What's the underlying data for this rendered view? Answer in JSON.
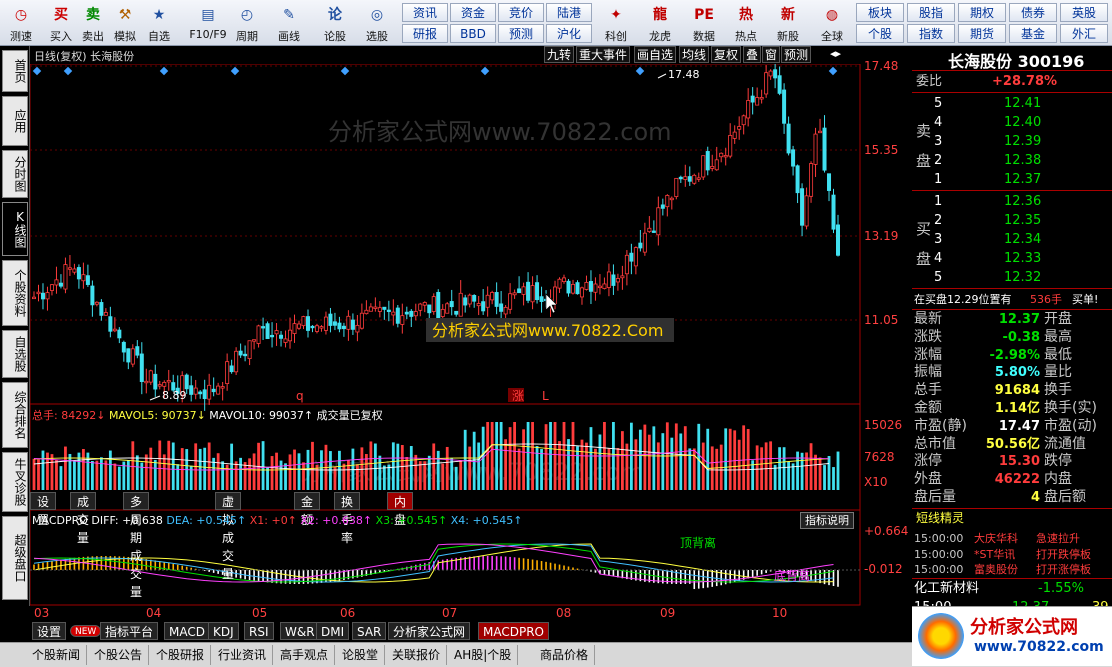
{
  "toolbar": {
    "buttons": [
      {
        "label": "测速",
        "icon": "clock-icon",
        "color": "#cc0000"
      },
      {
        "label": "买入",
        "icon": "buy-icon",
        "color": "#cc0000"
      },
      {
        "label": "卖出",
        "icon": "sell-icon",
        "color": "#008800"
      },
      {
        "label": "模拟",
        "icon": "hammer-icon",
        "color": "#b06000"
      },
      {
        "label": "自选",
        "icon": "star-icon",
        "color": "#2050a0"
      },
      {
        "label": "F10/F9",
        "icon": "document-icon",
        "color": "#2050a0"
      },
      {
        "label": "周期",
        "icon": "cycle-icon",
        "color": "#2050a0"
      },
      {
        "label": "画线",
        "icon": "pencil-icon",
        "color": "#2050a0"
      },
      {
        "label": "论股",
        "icon": "chat-icon",
        "color": "#2050a0"
      },
      {
        "label": "选股",
        "icon": "select-icon",
        "color": "#2050a0"
      }
    ],
    "grid_buttons": [
      [
        "资讯",
        "资金",
        "竞价",
        "陆港"
      ],
      [
        "研报",
        "BBD",
        "预测",
        "沪化"
      ]
    ],
    "app_buttons": [
      {
        "label": "科创",
        "icon": "sparkle-icon"
      },
      {
        "label": "龙虎",
        "icon": "dragon-icon"
      },
      {
        "label": "数据",
        "icon": "pe-icon"
      },
      {
        "label": "热点",
        "icon": "hot-icon"
      },
      {
        "label": "新股",
        "icon": "new-stock-icon"
      },
      {
        "label": "全球",
        "icon": "globe-icon"
      }
    ],
    "right_grid": [
      [
        "板块",
        "股指",
        "期权",
        "债券",
        "英股"
      ],
      [
        "个股",
        "指数",
        "期货",
        "基金",
        "外汇"
      ]
    ]
  },
  "left_tabs": [
    "首页",
    "应用",
    "分时图",
    "K线图",
    "个股资料",
    "自选股",
    "综合排名",
    "牛叉诊股",
    "超级盘口"
  ],
  "left_active": "K线图",
  "chart_title": {
    "left": "日线(复权)  长海股份",
    "right_tools": [
      "九转",
      "重大事件",
      "画自选",
      "均线",
      "复权",
      "叠",
      "窗",
      "预测"
    ]
  },
  "watermark_text": "分析家公式网www.70822.com",
  "watermark_label": "分析家公式网www.70822.Com",
  "price_axis": [
    "17.48",
    "15.35",
    "13.19",
    "11.05"
  ],
  "annotations": {
    "high": "17.48",
    "low": "8.89",
    "marks": [
      "q",
      "涨",
      "L"
    ]
  },
  "volume_header": {
    "total_label": "总手:",
    "total": "84292↓",
    "mavol5_label": "MAVOL5:",
    "mavol5": "90737↓",
    "mavol10_label": "MAVOL10:",
    "mavol10": "99037↑",
    "note": "成交量已复权"
  },
  "volume_axis": [
    "15026",
    "7628",
    "X10"
  ],
  "sub_tabs": [
    "设置",
    "成交量",
    "多周期成交量",
    "虚拟成交量",
    "金额",
    "换手率",
    "内盘"
  ],
  "sub_tab_active": "内盘",
  "macd_header": {
    "name": "MACDPRO DIFF:",
    "diff": "+0.638",
    "dea": "DEA: +0.545↑",
    "x1": "X1: +0↑",
    "x2": "X2: +0.638↑",
    "x3": "X3: +0.545↑",
    "x4": "X4: +0.545↑",
    "help": "指标说明"
  },
  "macd_axis": [
    "+0.664",
    "-0.012"
  ],
  "macd_annotations": [
    "顶背离",
    "底背离"
  ],
  "months": [
    "03",
    "04",
    "05",
    "06",
    "07",
    "08",
    "09",
    "10"
  ],
  "bottom_tabs": [
    "设置",
    "NEW",
    "指标平台",
    "MACD",
    "KDJ",
    "RSI",
    "W&R",
    "DMI",
    "SAR",
    "分析家公式网",
    "MACDPRO"
  ],
  "bottom_active": "MACDPRO",
  "status_tabs": [
    "个股新闻",
    "个股公告",
    "个股研报",
    "行业资讯",
    "高手观点",
    "论股堂",
    "关联报价",
    "AH股|个股",
    "商品价格"
  ],
  "right": {
    "stock_name": "长海股份",
    "stock_code": "300196",
    "weibi_label": "委比",
    "weibi": "+28.78%",
    "sell_label": "卖盘",
    "buy_label": "买盘",
    "sells": [
      {
        "n": "5",
        "p": "12.41",
        "v": ""
      },
      {
        "n": "4",
        "p": "12.40",
        "v": ""
      },
      {
        "n": "3",
        "p": "12.39",
        "v": ""
      },
      {
        "n": "2",
        "p": "12.38",
        "v": ""
      },
      {
        "n": "1",
        "p": "12.37",
        "v": ""
      }
    ],
    "buys": [
      {
        "n": "1",
        "p": "12.36",
        "v": ""
      },
      {
        "n": "2",
        "p": "12.35",
        "v": ""
      },
      {
        "n": "3",
        "p": "12.34",
        "v": ""
      },
      {
        "n": "4",
        "p": "12.33",
        "v": ""
      },
      {
        "n": "5",
        "p": "12.32",
        "v": ""
      }
    ],
    "buyline": {
      "left": "在买盘12.29位置有",
      "qty": "536手",
      "right": "买单!"
    },
    "quotes": [
      {
        "k": "最新",
        "v": "12.37",
        "c": "green",
        "k2": "开盘"
      },
      {
        "k": "涨跌",
        "v": "-0.38",
        "c": "green",
        "k2": "最高"
      },
      {
        "k": "涨幅",
        "v": "-2.98%",
        "c": "green",
        "k2": "最低"
      },
      {
        "k": "振幅",
        "v": "5.80%",
        "c": "cyan",
        "k2": "量比"
      },
      {
        "k": "总手",
        "v": "91684",
        "c": "yellow",
        "k2": "换手"
      },
      {
        "k": "金额",
        "v": "1.14亿",
        "c": "yellow",
        "k2": "换手(实)"
      },
      {
        "k": "市盈(静)",
        "v": "17.47",
        "c": "white",
        "k2": "市盈(动)"
      },
      {
        "k": "总市值",
        "v": "50.56亿",
        "c": "yellow",
        "k2": "流通值"
      },
      {
        "k": "涨停",
        "v": "15.30",
        "c": "red",
        "k2": "跌停"
      },
      {
        "k": "外盘",
        "v": "46222",
        "c": "red",
        "k2": "内盘"
      },
      {
        "k": "盘后量",
        "v": "4",
        "c": "yellow",
        "k2": "盘后额"
      }
    ],
    "short_title": "短线精灵",
    "short_items": [
      {
        "t": "15:00:00",
        "n": "大庆华科",
        "e": "急速拉升"
      },
      {
        "t": "15:00:00",
        "n": "*ST华讯",
        "e": "打开跌停板"
      },
      {
        "t": "15:00:00",
        "n": "富奥股份",
        "e": "打开涨停板"
      }
    ],
    "sector": {
      "name": "化工新材料",
      "chg": "-1.55%"
    },
    "tick": {
      "t": "15:00",
      "p": "12.37",
      "v": "39"
    }
  },
  "logo_text": "分析家公式网",
  "logo_url": "www.70822.com",
  "chart_data": [
    {
      "type": "candlestick",
      "x": [
        "03",
        "04",
        "05",
        "06",
        "07",
        "08",
        "09",
        "10"
      ],
      "ylim": [
        8.89,
        17.48
      ],
      "monthly_close": [
        11.3,
        9.3,
        10.6,
        11.2,
        11.0,
        13.4,
        16.5,
        14.7
      ],
      "high": 17.48,
      "low": 8.89
    },
    {
      "type": "bar",
      "series": [
        {
          "name": "总手",
          "values": [
            84292
          ]
        },
        {
          "name": "MAVOL5",
          "values": [
            90737
          ]
        },
        {
          "name": "MAVOL10",
          "values": [
            99037
          ]
        }
      ],
      "ylim": [
        0,
        15026
      ]
    },
    {
      "type": "line",
      "series": [
        {
          "name": "DIFF",
          "values": [
            0.638
          ]
        },
        {
          "name": "DEA",
          "values": [
            0.545
          ]
        }
      ],
      "ylim": [
        -0.012,
        0.664
      ]
    }
  ]
}
